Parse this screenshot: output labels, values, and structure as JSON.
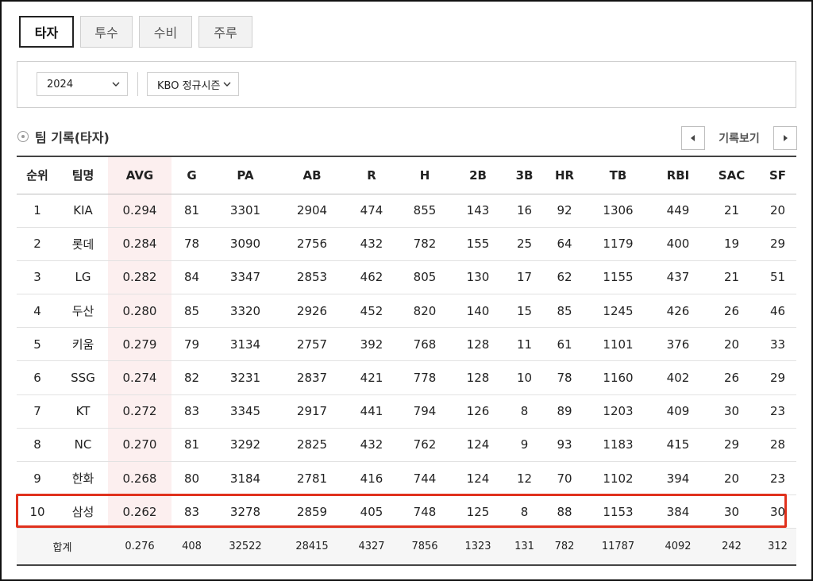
{
  "tabs": [
    "타자",
    "투수",
    "수비",
    "주루"
  ],
  "filters": {
    "year": "2024",
    "season": "KBO 정규시즌"
  },
  "section": {
    "title": "팀 기록(타자)",
    "pager_label": "기록보기"
  },
  "table": {
    "headers": [
      "순위",
      "팀명",
      "AVG",
      "G",
      "PA",
      "AB",
      "R",
      "H",
      "2B",
      "3B",
      "HR",
      "TB",
      "RBI",
      "SAC",
      "SF"
    ],
    "rows": [
      [
        "1",
        "KIA",
        "0.294",
        "81",
        "3301",
        "2904",
        "474",
        "855",
        "143",
        "16",
        "92",
        "1306",
        "449",
        "21",
        "20"
      ],
      [
        "2",
        "롯데",
        "0.284",
        "78",
        "3090",
        "2756",
        "432",
        "782",
        "155",
        "25",
        "64",
        "1179",
        "400",
        "19",
        "29"
      ],
      [
        "3",
        "LG",
        "0.282",
        "84",
        "3347",
        "2853",
        "462",
        "805",
        "130",
        "17",
        "62",
        "1155",
        "437",
        "21",
        "51"
      ],
      [
        "4",
        "두산",
        "0.280",
        "85",
        "3320",
        "2926",
        "452",
        "820",
        "140",
        "15",
        "85",
        "1245",
        "426",
        "26",
        "46"
      ],
      [
        "5",
        "키움",
        "0.279",
        "79",
        "3134",
        "2757",
        "392",
        "768",
        "128",
        "11",
        "61",
        "1101",
        "376",
        "20",
        "33"
      ],
      [
        "6",
        "SSG",
        "0.274",
        "82",
        "3231",
        "2837",
        "421",
        "778",
        "128",
        "10",
        "78",
        "1160",
        "402",
        "26",
        "29"
      ],
      [
        "7",
        "KT",
        "0.272",
        "83",
        "3345",
        "2917",
        "441",
        "794",
        "126",
        "8",
        "89",
        "1203",
        "409",
        "30",
        "23"
      ],
      [
        "8",
        "NC",
        "0.270",
        "81",
        "3292",
        "2825",
        "432",
        "762",
        "124",
        "9",
        "93",
        "1183",
        "415",
        "29",
        "28"
      ],
      [
        "9",
        "한화",
        "0.268",
        "80",
        "3184",
        "2781",
        "416",
        "744",
        "124",
        "12",
        "70",
        "1102",
        "394",
        "20",
        "23"
      ],
      [
        "10",
        "삼성",
        "0.262",
        "83",
        "3278",
        "2859",
        "405",
        "748",
        "125",
        "8",
        "88",
        "1153",
        "384",
        "30",
        "30"
      ]
    ],
    "total": [
      "합계",
      "0.276",
      "408",
      "32522",
      "28415",
      "4327",
      "7856",
      "1323",
      "131",
      "782",
      "11787",
      "4092",
      "242",
      "312"
    ]
  },
  "colors": {
    "highlight": "#e0311d",
    "avg_column": "#fcefef"
  }
}
